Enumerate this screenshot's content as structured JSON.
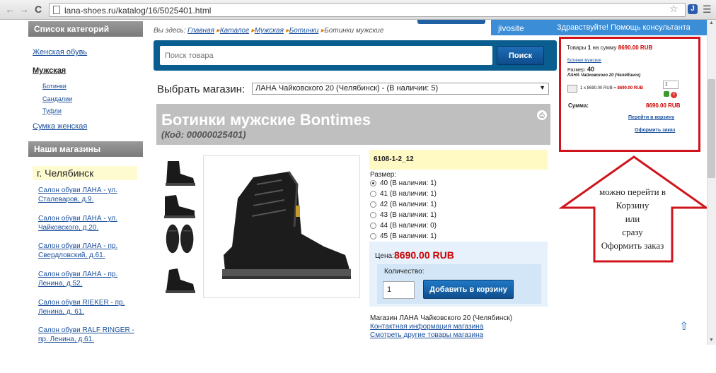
{
  "browser": {
    "url": "lana-shoes.ru/katalog/16/5025401.html"
  },
  "sidebar": {
    "categories_title": "Список категорий",
    "items": [
      {
        "label": "Женская обувь"
      },
      {
        "label": "Мужская"
      },
      {
        "label": "Ботинки"
      },
      {
        "label": "Сандалии"
      },
      {
        "label": "Туфли"
      },
      {
        "label": "Сумка женская"
      }
    ],
    "stores_title": "Наши магазины",
    "city": "г. Челябинск",
    "stores": [
      {
        "label": "Салон обуви ЛАНА - ул. Сталеваров, д.9."
      },
      {
        "label": "Салон обуви ЛАНА - ул. Чайковского, д.20."
      },
      {
        "label": "Салон обуви ЛАНА - пр. Свердловский, д.61."
      },
      {
        "label": "Салон обуви ЛАНА - пр. Ленина, д.52."
      },
      {
        "label": "Салон обуви RIEKER - пр. Ленина, д. 61."
      },
      {
        "label": "Салон обуви RALF RINGER - пр. Ленина, д.61."
      }
    ]
  },
  "breadcrumb": {
    "prefix": "Вы здесь:",
    "items": [
      "Главная",
      "Каталог",
      "Мужская",
      "Ботинки"
    ],
    "current": "Ботинки мужские"
  },
  "search": {
    "placeholder": "Поиск товара",
    "button": "Поиск"
  },
  "store_select": {
    "label": "Выбрать магазин:",
    "value": "ЛАНА Чайковского 20 (Челябинск) - (В наличии: 5)"
  },
  "product": {
    "title": "Ботинки мужские Bontimes",
    "code": "(Код: 00000025401)",
    "article": "6108-1-2_12",
    "size_title": "Размер:",
    "sizes": [
      {
        "label": "40 (В наличии: 1)",
        "selected": true
      },
      {
        "label": "41 (В наличии: 1)",
        "selected": false
      },
      {
        "label": "42 (В наличии: 1)",
        "selected": false
      },
      {
        "label": "43 (В наличии: 1)",
        "selected": false
      },
      {
        "label": "44 (В наличии: 0)",
        "selected": false
      },
      {
        "label": "45 (В наличии: 1)",
        "selected": false
      }
    ],
    "price_label": "Цена:",
    "price": "8690.00 RUB",
    "qty_label": "Количество:",
    "qty": "1",
    "add_button": "Добавить в корзину",
    "store_name": "Магазин ЛАНА Чайковского 20 (Челябинск)",
    "contact_link": "Контактная информация магазина",
    "other_link": "Смотреть другие товары магазина"
  },
  "chat": {
    "logo": "jivosite",
    "text": "Здравствуйте! Помощь консультанта"
  },
  "cart": {
    "summary_a": "Товары",
    "summary_count": "1",
    "summary_b": "на сумму",
    "summary_value": "8690.00 RUB",
    "item_link": "Ботинки мужские",
    "size_label": "Размер:",
    "size_value": "40",
    "store": "ЛАНА Чайковского 20 (Челябинск)",
    "qty": "1",
    "line_a": "1 x 8690.00 RUB =",
    "line_total": "8690.00 RUB",
    "total_label": "Сумма:",
    "total_value": "8690.00 RUB",
    "go_cart": "Перейти в корзину",
    "checkout": "Оформить заказ"
  },
  "annotation": {
    "lines": [
      "можно перейти в",
      "Корзину",
      "или",
      "сразу",
      "Оформить заказ"
    ]
  },
  "colors": {
    "accent_blue": "#0a5d8f",
    "annotation_red": "#d0141b",
    "price_red": "#c00000"
  }
}
